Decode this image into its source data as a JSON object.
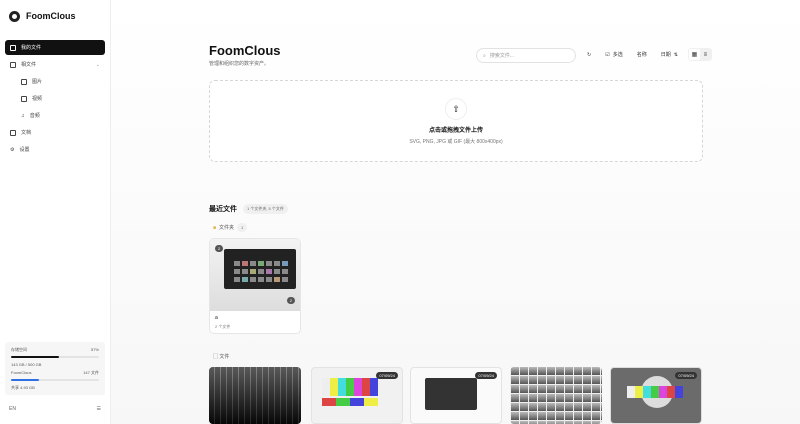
{
  "app": {
    "name": "FoomClous"
  },
  "sidebar": {
    "items": [
      {
        "label": "我的文件",
        "icon": "folder-icon"
      },
      {
        "label": "相文件",
        "icon": "image-icon"
      },
      {
        "label": "图片",
        "icon": "photo-icon"
      },
      {
        "label": "视频",
        "icon": "video-icon"
      },
      {
        "label": "音频",
        "icon": "music-icon"
      },
      {
        "label": "文档",
        "icon": "document-icon"
      },
      {
        "label": "设置",
        "icon": "gear-icon"
      }
    ],
    "storage": {
      "label": "存储空间",
      "percent_text": "57%",
      "used_fraction": 0.55,
      "usage_text": "143 GB / 500 GB",
      "app_label": "FoomClous",
      "count_text": "147 文件",
      "app_fraction": 0.32,
      "app_sub": "共享 4.93 GB"
    },
    "footer": {
      "lang": "EN",
      "menu_icon": "menu-icon"
    }
  },
  "header": {
    "title": "FoomClous",
    "subtitle": "管理和组织您的数字资产。",
    "search_placeholder": "搜索文件...",
    "select_label": "多选",
    "sort_label": "名称",
    "date_label": "日期"
  },
  "upload": {
    "title": "点击或拖拽文件上传",
    "subtitle": "SVG, PNG, JPG 或 GIF (最大 800x400px)"
  },
  "recent": {
    "heading": "最近文件",
    "count_pill": "1 个文件夹, 5 个文件",
    "folders_label": "文件夹",
    "folders_count": "1",
    "folder": {
      "name": "a",
      "sub": "2 个文件",
      "badge_top": "2",
      "badge_bottom": "2"
    },
    "files_label": "文件",
    "files": [
      {
        "badge": ""
      },
      {
        "badge": "07/09/24"
      },
      {
        "badge": "07/09/24"
      },
      {
        "badge": ""
      },
      {
        "badge": "07/09/24"
      }
    ]
  }
}
